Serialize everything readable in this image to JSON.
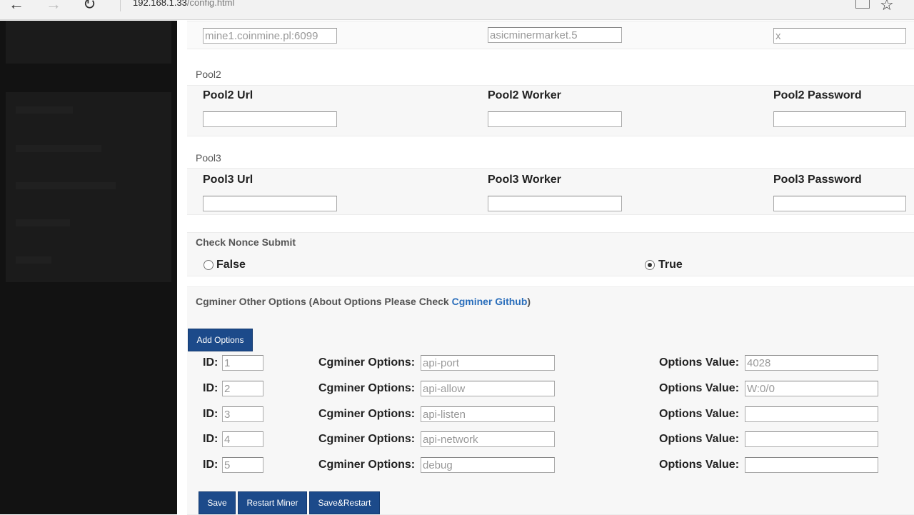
{
  "browser": {
    "url_host": "192.168.1.33",
    "url_path": "/config.html"
  },
  "pool1": {
    "url_value": "mine1.coinmine.pl:6099",
    "worker_value": "asicminermarket.5",
    "password_value": "x"
  },
  "pool2": {
    "title": "Pool2",
    "url_label": "Pool2 Url",
    "worker_label": "Pool2 Worker",
    "password_label": "Pool2 Password",
    "url_value": "",
    "worker_value": "",
    "password_value": ""
  },
  "pool3": {
    "title": "Pool3",
    "url_label": "Pool3 Url",
    "worker_label": "Pool3 Worker",
    "password_label": "Pool3 Password",
    "url_value": "",
    "worker_value": "",
    "password_value": ""
  },
  "nonce": {
    "title": "Check Nonce Submit",
    "false_label": "False",
    "true_label": "True",
    "selected": "True"
  },
  "cgminer": {
    "title_prefix": "Cgminer Other Options (About Options Please Check ",
    "link_text": "Cgminer Github",
    "title_suffix": ")",
    "add_button": "Add Options",
    "id_label": "ID:",
    "options_label": "Cgminer Options:",
    "value_label": "Options Value:",
    "rows": [
      {
        "id": "1",
        "option": "api-port",
        "value": "4028"
      },
      {
        "id": "2",
        "option": "api-allow",
        "value": "W:0/0"
      },
      {
        "id": "3",
        "option": "api-listen",
        "value": ""
      },
      {
        "id": "4",
        "option": "api-network",
        "value": ""
      },
      {
        "id": "5",
        "option": "debug",
        "value": ""
      }
    ]
  },
  "actions": {
    "save": "Save",
    "restart": "Restart Miner",
    "save_restart": "Save&Restart"
  }
}
